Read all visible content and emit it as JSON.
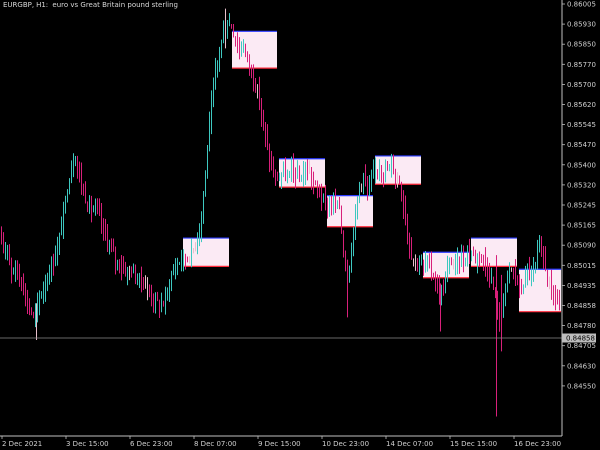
{
  "window": {
    "symbol": "EURGBP,",
    "timeframe": "H1:",
    "description": "euro vs Great Britain pound sterling"
  },
  "price_axis": {
    "labels": [
      "0.86005",
      "0.85930",
      "0.85850",
      "0.85770",
      "0.85700",
      "0.85620",
      "0.85545",
      "0.85470",
      "0.85400",
      "0.85320",
      "0.85245",
      "0.85165",
      "0.85090",
      "0.85015",
      "0.84935",
      "0.84858",
      "0.84780",
      "0.84705",
      "0.84630",
      "0.84550"
    ],
    "current_price": "0.84858"
  },
  "time_axis": {
    "labels": [
      "2 Dec 2021",
      "3 Dec 15:00",
      "6 Dec 23:00",
      "8 Dec 07:00",
      "9 Dec 15:00",
      "10 Dec 23:00",
      "14 Dec 07:00",
      "15 Dec 15:00",
      "16 Dec 23:00"
    ]
  },
  "colors": {
    "background": "#000000",
    "bull_candle": "#3ec8c0",
    "bear_candle": "#d8207a",
    "neutral_candle": "#e8c0cc",
    "zone_fill": "#fbeaf4",
    "zone_top_border": "#2a3aff",
    "zone_bottom_border": "#ff2a3a",
    "axis_line": "#bfbfbf",
    "text": "#d0d0d0",
    "bid_line": "#8a8a8a",
    "price_label_bg": "#bdbdbd"
  },
  "chart_data": {
    "type": "candlestick",
    "ylim": [
      0.8452,
      0.8601
    ],
    "price_path": [
      [
        0,
        0.8518
      ],
      [
        3,
        0.8513
      ],
      [
        8,
        0.8516
      ],
      [
        12,
        0.8506
      ],
      [
        16,
        0.8508
      ],
      [
        20,
        0.8504
      ],
      [
        24,
        0.8501
      ],
      [
        28,
        0.8494
      ],
      [
        32,
        0.8492
      ],
      [
        35,
        0.8489
      ],
      [
        40,
        0.8497
      ],
      [
        46,
        0.8502
      ],
      [
        52,
        0.8508
      ],
      [
        56,
        0.8512
      ],
      [
        60,
        0.8518
      ],
      [
        64,
        0.8527
      ],
      [
        68,
        0.8536
      ],
      [
        72,
        0.8543
      ],
      [
        76,
        0.8547
      ],
      [
        80,
        0.854
      ],
      [
        84,
        0.8534
      ],
      [
        88,
        0.853
      ],
      [
        92,
        0.8528
      ],
      [
        96,
        0.8528
      ],
      [
        100,
        0.8526
      ],
      [
        104,
        0.852
      ],
      [
        108,
        0.8517
      ],
      [
        112,
        0.8514
      ],
      [
        116,
        0.851
      ],
      [
        120,
        0.8509
      ],
      [
        124,
        0.8507
      ],
      [
        128,
        0.8506
      ],
      [
        132,
        0.8507
      ],
      [
        136,
        0.8504
      ],
      [
        140,
        0.8504
      ],
      [
        144,
        0.8502
      ],
      [
        148,
        0.85
      ],
      [
        152,
        0.8497
      ],
      [
        156,
        0.8496
      ],
      [
        160,
        0.8494
      ],
      [
        164,
        0.8495
      ],
      [
        168,
        0.8499
      ],
      [
        172,
        0.8505
      ],
      [
        176,
        0.8508
      ],
      [
        180,
        0.851
      ],
      [
        184,
        0.8511
      ],
      [
        188,
        0.8511
      ],
      [
        192,
        0.8513
      ],
      [
        196,
        0.8516
      ],
      [
        200,
        0.8522
      ],
      [
        204,
        0.8533
      ],
      [
        208,
        0.855
      ],
      [
        212,
        0.8565
      ],
      [
        216,
        0.8576
      ],
      [
        220,
        0.8585
      ],
      [
        224,
        0.859
      ],
      [
        228,
        0.8594
      ],
      [
        232,
        0.8593
      ],
      [
        236,
        0.8588
      ],
      [
        240,
        0.8584
      ],
      [
        244,
        0.8586
      ],
      [
        248,
        0.8581
      ],
      [
        252,
        0.8577
      ],
      [
        256,
        0.8572
      ],
      [
        260,
        0.8566
      ],
      [
        264,
        0.8558
      ],
      [
        268,
        0.8549
      ],
      [
        272,
        0.8543
      ],
      [
        276,
        0.8538
      ],
      [
        280,
        0.854
      ],
      [
        284,
        0.8541
      ],
      [
        288,
        0.8539
      ],
      [
        292,
        0.8542
      ],
      [
        296,
        0.8541
      ],
      [
        300,
        0.8538
      ],
      [
        304,
        0.8541
      ],
      [
        308,
        0.8542
      ],
      [
        312,
        0.8539
      ],
      [
        316,
        0.8536
      ],
      [
        320,
        0.8534
      ],
      [
        324,
        0.8531
      ],
      [
        328,
        0.8529
      ],
      [
        332,
        0.853
      ],
      [
        336,
        0.853
      ],
      [
        340,
        0.8529
      ],
      [
        344,
        0.8513
      ],
      [
        348,
        0.8504
      ],
      [
        352,
        0.8515
      ],
      [
        356,
        0.8527
      ],
      [
        360,
        0.8537
      ],
      [
        364,
        0.854
      ],
      [
        368,
        0.8534
      ],
      [
        372,
        0.8538
      ],
      [
        376,
        0.8542
      ],
      [
        380,
        0.8544
      ],
      [
        384,
        0.8541
      ],
      [
        388,
        0.8542
      ],
      [
        392,
        0.8544
      ],
      [
        396,
        0.854
      ],
      [
        400,
        0.8538
      ],
      [
        404,
        0.853
      ],
      [
        408,
        0.852
      ],
      [
        412,
        0.8512
      ],
      [
        416,
        0.851
      ],
      [
        420,
        0.8509
      ],
      [
        424,
        0.8508
      ],
      [
        428,
        0.851
      ],
      [
        432,
        0.8506
      ],
      [
        436,
        0.8503
      ],
      [
        440,
        0.8498
      ],
      [
        444,
        0.85
      ],
      [
        448,
        0.8507
      ],
      [
        452,
        0.851
      ],
      [
        456,
        0.8508
      ],
      [
        460,
        0.8511
      ],
      [
        464,
        0.851
      ],
      [
        468,
        0.8513
      ],
      [
        472,
        0.8513
      ],
      [
        476,
        0.8511
      ],
      [
        480,
        0.8513
      ],
      [
        484,
        0.851
      ],
      [
        488,
        0.8507
      ],
      [
        492,
        0.8503
      ],
      [
        496,
        0.8497
      ],
      [
        500,
        0.8488
      ],
      [
        504,
        0.8498
      ],
      [
        508,
        0.8505
      ],
      [
        512,
        0.8507
      ],
      [
        516,
        0.8505
      ],
      [
        520,
        0.8499
      ],
      [
        524,
        0.8502
      ],
      [
        528,
        0.8507
      ],
      [
        532,
        0.8505
      ],
      [
        536,
        0.8508
      ],
      [
        540,
        0.8515
      ],
      [
        544,
        0.8511
      ],
      [
        548,
        0.8504
      ],
      [
        552,
        0.8499
      ],
      [
        556,
        0.8497
      ],
      [
        560,
        0.8494
      ]
    ],
    "zones": [
      {
        "x_start": 183,
        "x_end": 229,
        "top": 0.8518,
        "bottom": 0.8508
      },
      {
        "x_start": 232,
        "x_end": 277,
        "top": 0.8591,
        "bottom": 0.8578
      },
      {
        "x_start": 279,
        "x_end": 325,
        "top": 0.8546,
        "bottom": 0.8536
      },
      {
        "x_start": 327,
        "x_end": 373,
        "top": 0.8533,
        "bottom": 0.8522
      },
      {
        "x_start": 375,
        "x_end": 421,
        "top": 0.8547,
        "bottom": 0.8537
      },
      {
        "x_start": 423,
        "x_end": 469,
        "top": 0.8513,
        "bottom": 0.8504
      },
      {
        "x_start": 471,
        "x_end": 517,
        "top": 0.8518,
        "bottom": 0.8508
      },
      {
        "x_start": 519,
        "x_end": 561,
        "top": 0.8507,
        "bottom": 0.8492
      }
    ],
    "grid": false
  }
}
